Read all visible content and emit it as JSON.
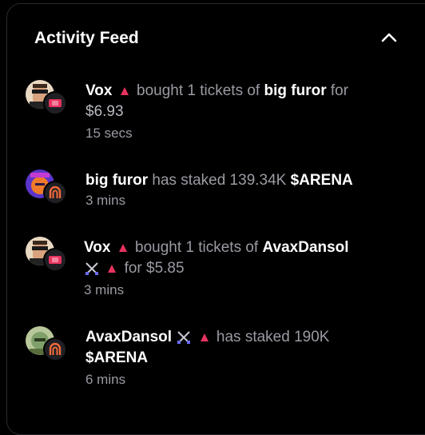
{
  "header": {
    "title": "Activity Feed"
  },
  "feed": [
    {
      "name": "Vox",
      "action": "bought 1 tickets of",
      "target": "big furor",
      "suffix": "for",
      "amount": "$6.93",
      "time": "15 secs"
    },
    {
      "name": "big furor",
      "action": "has staked 139.34K",
      "token": "$ARENA",
      "time": "3 mins"
    },
    {
      "name": "Vox",
      "action": "bought 1 tickets of",
      "target": "AvaxDansol",
      "suffix": "for $5.85",
      "time": "3 mins"
    },
    {
      "name": "AvaxDansol",
      "action": "has staked 190K",
      "token": "$ARENA",
      "time": "6 mins"
    }
  ],
  "colors": {
    "accent": "#e8335f",
    "badge_orange": "#f06a3a",
    "muted_text": "#9a9aa3"
  }
}
